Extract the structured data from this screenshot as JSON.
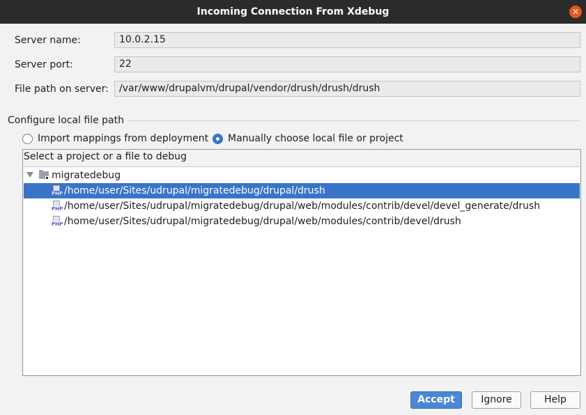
{
  "window": {
    "title": "Incoming Connection From Xdebug",
    "close_glyph": "✕"
  },
  "fields": {
    "server_name_label": "Server name:",
    "server_name_value": "10.0.2.15",
    "server_port_label": "Server port:",
    "server_port_value": "22",
    "file_path_label": "File path on server:",
    "file_path_value": "/var/www/drupalvm/drupal/vendor/drush/drush/drush"
  },
  "local_path": {
    "section_title": "Configure local file path",
    "option_import": "Import mappings from deployment",
    "option_manual": "Manually choose local file or project",
    "selected_option": "manual",
    "panel_title": "Select a project or a file to debug"
  },
  "tree": {
    "root_label": "migratedebug",
    "items": [
      {
        "label": "/home/user/Sites/udrupal/migratedebug/drupal/drush",
        "selected": true
      },
      {
        "label": "/home/user/Sites/udrupal/migratedebug/drupal/web/modules/contrib/devel/devel_generate/drush",
        "selected": false
      },
      {
        "label": "/home/user/Sites/udrupal/migratedebug/drupal/web/modules/contrib/devel/drush",
        "selected": false
      }
    ],
    "file_icon_tag": "PHP"
  },
  "buttons": {
    "accept": "Accept",
    "ignore": "Ignore",
    "help": "Help"
  },
  "colors": {
    "accent": "#3a74c9",
    "titlebar": "#2b2b2b",
    "close": "#e95420"
  }
}
